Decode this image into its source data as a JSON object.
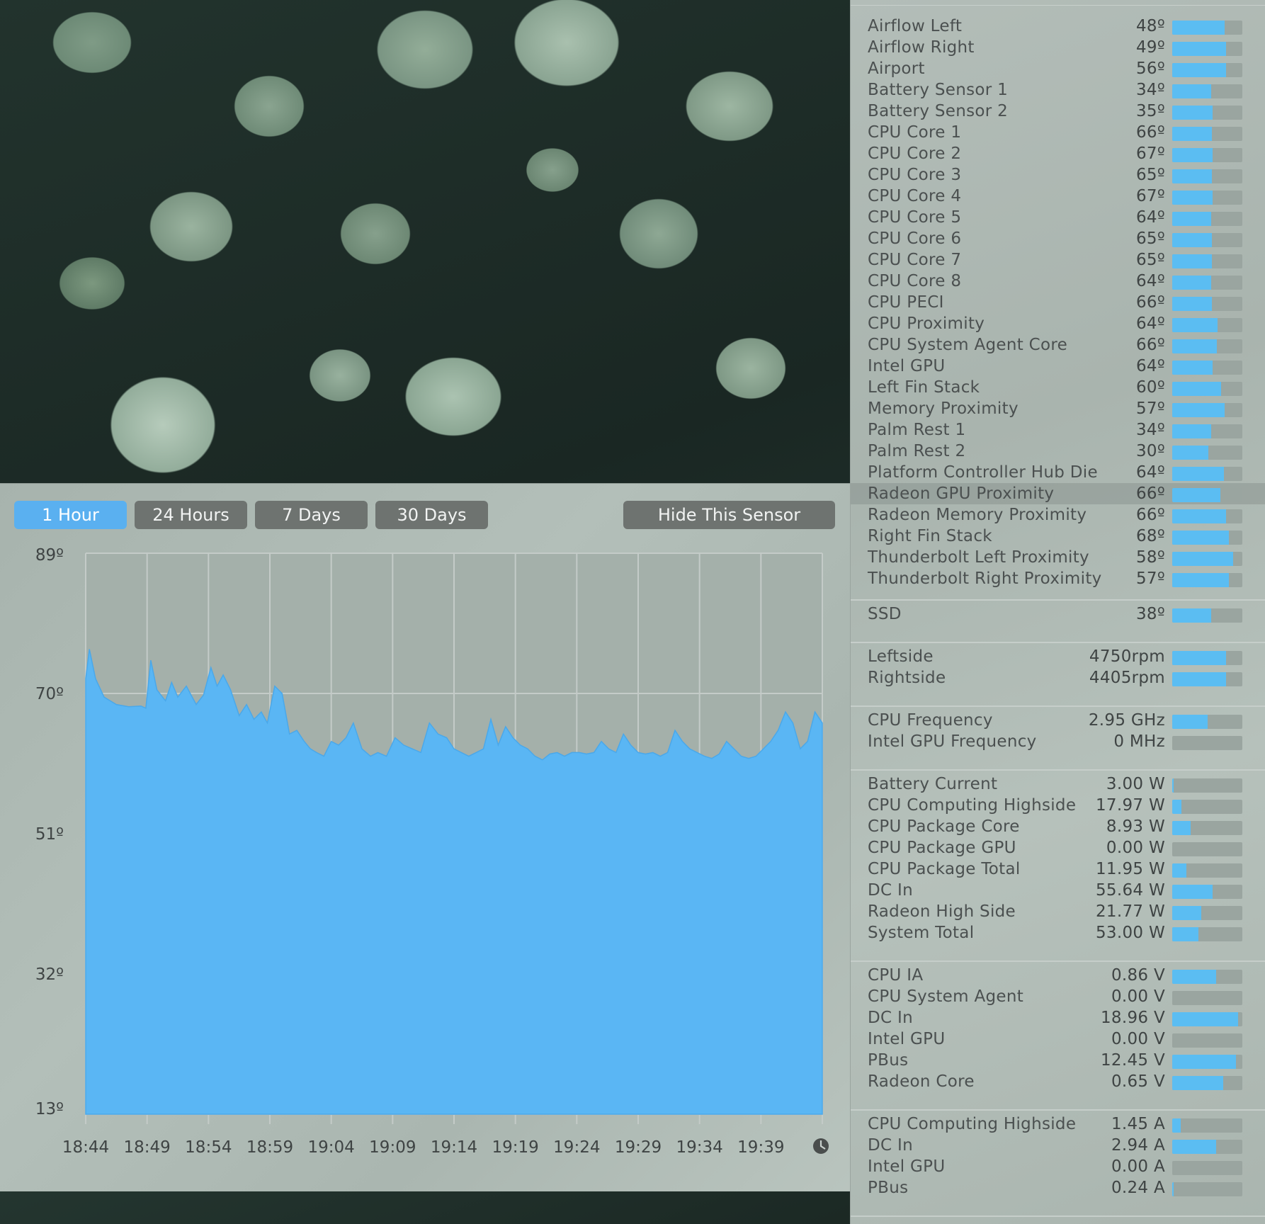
{
  "chart_window": {
    "range_buttons": [
      {
        "label": "1 Hour",
        "active": true
      },
      {
        "label": "24 Hours",
        "active": false
      },
      {
        "label": "7 Days",
        "active": false
      },
      {
        "label": "30 Days",
        "active": false
      }
    ],
    "hide_button_label": "Hide This Sensor"
  },
  "chart_data": {
    "type": "area",
    "title": "",
    "xlabel": "",
    "ylabel": "",
    "y_tick_labels": [
      "89º",
      "70º",
      "51º",
      "32º",
      "13º"
    ],
    "y_ticks": [
      89,
      70,
      51,
      32,
      13
    ],
    "ylim": [
      13,
      89
    ],
    "x_tick_labels": [
      "18:44",
      "18:49",
      "18:54",
      "18:59",
      "19:04",
      "19:09",
      "19:14",
      "19:19",
      "19:24",
      "19:29",
      "19:34",
      "19:39"
    ],
    "x_range_minutes": [
      0,
      60
    ],
    "series": [
      {
        "color": "#5ab6f4",
        "x_minutes": [
          0,
          0.3,
          0.8,
          1.5,
          2.5,
          3.5,
          4.5,
          4.9,
          5.3,
          5.8,
          6.5,
          7.0,
          7.5,
          8.2,
          9.0,
          9.6,
          10.2,
          10.7,
          11.2,
          11.8,
          12.5,
          13.1,
          13.7,
          14.3,
          14.8,
          15.4,
          16.0,
          16.6,
          17.2,
          17.8,
          18.3,
          18.8,
          19.4,
          20.0,
          20.6,
          21.2,
          21.8,
          22.5,
          23.2,
          23.8,
          24.5,
          25.2,
          25.9,
          26.6,
          27.3,
          28.0,
          28.7,
          29.4,
          30.0,
          30.6,
          31.2,
          31.8,
          32.4,
          33.0,
          33.6,
          34.2,
          34.8,
          35.4,
          36.0,
          36.6,
          37.2,
          37.8,
          38.4,
          39.0,
          39.6,
          40.2,
          40.8,
          41.4,
          42.0,
          42.6,
          43.2,
          43.8,
          44.4,
          45.0,
          45.6,
          46.2,
          46.8,
          47.4,
          48.0,
          48.6,
          49.2,
          49.8,
          50.4,
          51.0,
          51.6,
          52.2,
          52.8,
          53.4,
          54.0,
          54.6,
          55.2,
          55.8,
          56.4,
          57.0,
          57.6,
          58.2,
          58.8,
          59.4,
          60.0
        ],
        "values": [
          72,
          76,
          72,
          69.5,
          68.5,
          68.2,
          68.3,
          68.0,
          74.5,
          70.5,
          69,
          71.5,
          69.5,
          71,
          68.5,
          69.8,
          73.5,
          71,
          72.5,
          70.5,
          67,
          68.5,
          66.5,
          67.5,
          66,
          71,
          70,
          64.5,
          65,
          63.5,
          62.5,
          62,
          61.5,
          63.5,
          63,
          64,
          66,
          62.5,
          61.5,
          62,
          61.5,
          64,
          63,
          62.5,
          62,
          66,
          64.5,
          64,
          62.5,
          62,
          61.5,
          62,
          62.5,
          66.5,
          63,
          65.5,
          64,
          63,
          62.5,
          61.5,
          61,
          61.8,
          62,
          61.5,
          62,
          62,
          61.8,
          62,
          63.5,
          62.5,
          62,
          64.5,
          63,
          62,
          61.8,
          62,
          61.5,
          62,
          65,
          63.5,
          62.5,
          62,
          61.5,
          61.2,
          61.8,
          63.5,
          62.5,
          61.5,
          61.2,
          61.5,
          62.5,
          63.5,
          65,
          67.5,
          66,
          62.5,
          63.5,
          67.5,
          66
        ]
      }
    ],
    "grid": true,
    "legend": "none"
  },
  "sensor_panel": {
    "groups": [
      {
        "rows": [
          {
            "name": "Airflow Left",
            "value": "48º",
            "level": 0.75
          },
          {
            "name": "Airflow Right",
            "value": "49º",
            "level": 0.77
          },
          {
            "name": "Airport",
            "value": "56º",
            "level": 0.77
          },
          {
            "name": "Battery Sensor 1",
            "value": "34º",
            "level": 0.56
          },
          {
            "name": "Battery Sensor 2",
            "value": "35º",
            "level": 0.58
          },
          {
            "name": "CPU Core 1",
            "value": "66º",
            "level": 0.57
          },
          {
            "name": "CPU Core 2",
            "value": "67º",
            "level": 0.58
          },
          {
            "name": "CPU Core 3",
            "value": "65º",
            "level": 0.57
          },
          {
            "name": "CPU Core 4",
            "value": "67º",
            "level": 0.58
          },
          {
            "name": "CPU Core 5",
            "value": "64º",
            "level": 0.56
          },
          {
            "name": "CPU Core 6",
            "value": "65º",
            "level": 0.57
          },
          {
            "name": "CPU Core 7",
            "value": "65º",
            "level": 0.57
          },
          {
            "name": "CPU Core 8",
            "value": "64º",
            "level": 0.56
          },
          {
            "name": "CPU PECI",
            "value": "66º",
            "level": 0.57
          },
          {
            "name": "CPU Proximity",
            "value": "64º",
            "level": 0.65
          },
          {
            "name": "CPU System Agent Core",
            "value": "66º",
            "level": 0.64
          },
          {
            "name": "Intel GPU",
            "value": "64º",
            "level": 0.58
          },
          {
            "name": "Left Fin Stack",
            "value": "60º",
            "level": 0.7
          },
          {
            "name": "Memory Proximity",
            "value": "57º",
            "level": 0.75
          },
          {
            "name": "Palm Rest 1",
            "value": "34º",
            "level": 0.56
          },
          {
            "name": "Palm Rest 2",
            "value": "30º",
            "level": 0.52
          },
          {
            "name": "Platform Controller Hub Die",
            "value": "64º",
            "level": 0.74
          },
          {
            "name": "Radeon GPU Proximity",
            "value": "66º",
            "level": 0.69,
            "selected": true
          },
          {
            "name": "Radeon Memory Proximity",
            "value": "66º",
            "level": 0.77
          },
          {
            "name": "Right Fin Stack",
            "value": "68º",
            "level": 0.81
          },
          {
            "name": "Thunderbolt Left Proximity",
            "value": "58º",
            "level": 0.87
          },
          {
            "name": "Thunderbolt Right Proximity",
            "value": "57º",
            "level": 0.81
          }
        ]
      },
      {
        "rows": [
          {
            "name": "SSD",
            "value": "38º",
            "level": 0.56
          }
        ]
      },
      {
        "rows": [
          {
            "name": "Leftside",
            "value": "4750rpm",
            "level": 0.77
          },
          {
            "name": "Rightside",
            "value": "4405rpm",
            "level": 0.77
          }
        ]
      },
      {
        "rows": [
          {
            "name": "CPU Frequency",
            "value": "2.95 GHz",
            "level": 0.5
          },
          {
            "name": "Intel GPU Frequency",
            "value": "0 MHz",
            "level": 0
          }
        ]
      },
      {
        "rows": [
          {
            "name": "Battery Current",
            "value": "3.00 W",
            "level": 0.02
          },
          {
            "name": "CPU Computing Highside",
            "value": "17.97 W",
            "level": 0.13
          },
          {
            "name": "CPU Package Core",
            "value": "8.93 W",
            "level": 0.26
          },
          {
            "name": "CPU Package GPU",
            "value": "0.00 W",
            "level": 0
          },
          {
            "name": "CPU Package Total",
            "value": "11.95 W",
            "level": 0.2
          },
          {
            "name": "DC In",
            "value": "55.64 W",
            "level": 0.58
          },
          {
            "name": "Radeon High Side",
            "value": "21.77 W",
            "level": 0.41
          },
          {
            "name": "System Total",
            "value": "53.00 W",
            "level": 0.37
          }
        ]
      },
      {
        "rows": [
          {
            "name": "CPU IA",
            "value": "0.86 V",
            "level": 0.63
          },
          {
            "name": "CPU System Agent",
            "value": "0.00 V",
            "level": 0
          },
          {
            "name": "DC In",
            "value": "18.96 V",
            "level": 0.94
          },
          {
            "name": "Intel GPU",
            "value": "0.00 V",
            "level": 0
          },
          {
            "name": "PBus",
            "value": "12.45 V",
            "level": 0.91
          },
          {
            "name": "Radeon Core",
            "value": "0.65 V",
            "level": 0.73
          }
        ]
      },
      {
        "rows": [
          {
            "name": "CPU Computing Highside",
            "value": "1.45 A",
            "level": 0.12
          },
          {
            "name": "DC In",
            "value": "2.94 A",
            "level": 0.63
          },
          {
            "name": "Intel GPU",
            "value": "0.00 A",
            "level": 0
          },
          {
            "name": "PBus",
            "value": "0.24 A",
            "level": 0.02
          }
        ]
      }
    ]
  }
}
